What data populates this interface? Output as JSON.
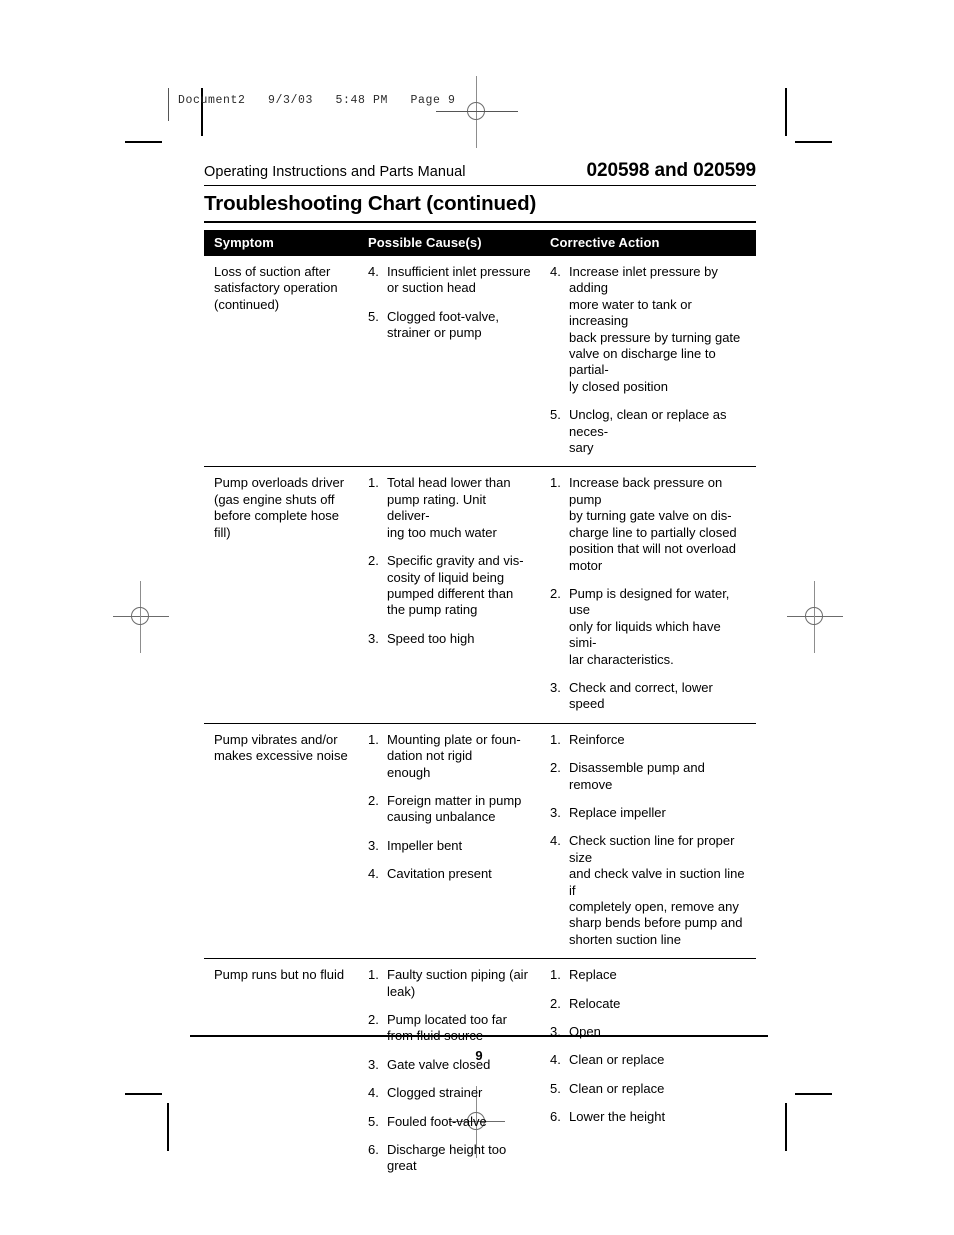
{
  "print_slug": {
    "text": "Document2   9/3/03   5:48 PM   Page 9"
  },
  "document": {
    "manual_line": "Operating Instructions and Parts Manual",
    "model_numbers": "020598 and 020599",
    "title": "Troubleshooting Chart (continued)",
    "page_number": "9"
  },
  "table": {
    "columns": [
      "Symptom",
      "Possible Cause(s)",
      "Corrective Action"
    ],
    "rows": [
      {
        "symptom": "Loss of suction after\nsatisfactory operation\n(continued)",
        "causes": [
          {
            "num": "4.",
            "text": "Insufficient inlet pressure\nor suction head"
          },
          {
            "num": "5.",
            "text": "Clogged foot-valve,\nstrainer or pump"
          }
        ],
        "actions": [
          {
            "num": "4.",
            "text": "Increase inlet pressure by adding\nmore water to tank or increasing\nback pressure by turning gate\nvalve on discharge line to partial-\nly closed position"
          },
          {
            "num": "5.",
            "text": "Unclog, clean or replace as neces-\nsary"
          }
        ]
      },
      {
        "symptom": "Pump overloads driver\n(gas engine shuts off\nbefore complete hose\nfill)",
        "causes": [
          {
            "num": "1.",
            "text": "Total head lower than\npump rating. Unit deliver-\ning too much water"
          },
          {
            "num": "2.",
            "text": "Specific gravity and vis-\ncosity of liquid being\npumped different than\nthe pump rating"
          },
          {
            "num": "3.",
            "text": "Speed too high"
          }
        ],
        "actions": [
          {
            "num": "1.",
            "text": "Increase back pressure on pump\nby turning gate valve on dis-\ncharge line to partially closed\nposition that will not overload\nmotor"
          },
          {
            "num": "2.",
            "text": "Pump is designed for water, use\nonly for liquids which have simi-\nlar characteristics."
          },
          {
            "num": "3.",
            "text": "Check and correct, lower speed"
          }
        ]
      },
      {
        "symptom": "Pump vibrates and/or\nmakes excessive noise",
        "causes": [
          {
            "num": "1.",
            "text": "Mounting plate or foun-\ndation not rigid\nenough"
          },
          {
            "num": "2.",
            "text": "Foreign matter in pump\ncausing unbalance"
          },
          {
            "num": "3.",
            "text": "Impeller bent"
          },
          {
            "num": "4.",
            "text": "Cavitation present"
          }
        ],
        "actions": [
          {
            "num": "1.",
            "text": "Reinforce"
          },
          {
            "num": "2.",
            "text": "Disassemble pump and remove"
          },
          {
            "num": "3.",
            "text": "Replace impeller"
          },
          {
            "num": "4.",
            "text": "Check suction line for proper size\nand check valve in suction line if\ncompletely open, remove any\nsharp bends before pump and\nshorten suction line"
          }
        ]
      },
      {
        "symptom": "Pump runs but no fluid",
        "causes": [
          {
            "num": "1.",
            "text": "Faulty suction piping (air\nleak)"
          },
          {
            "num": "2.",
            "text": "Pump located too far\nfrom fluid source"
          },
          {
            "num": "3.",
            "text": "Gate valve closed"
          },
          {
            "num": "4.",
            "text": "Clogged strainer"
          },
          {
            "num": "5.",
            "text": "Fouled foot-valve"
          },
          {
            "num": "6.",
            "text": "Discharge height too\ngreat"
          }
        ],
        "actions": [
          {
            "num": "1.",
            "text": "Replace"
          },
          {
            "num": "2.",
            "text": "Relocate"
          },
          {
            "num": "3.",
            "text": "Open"
          },
          {
            "num": "4.",
            "text": "Clean or replace"
          },
          {
            "num": "5.",
            "text": "Clean or replace"
          },
          {
            "num": "6.",
            "text": "Lower the height"
          }
        ]
      }
    ]
  }
}
